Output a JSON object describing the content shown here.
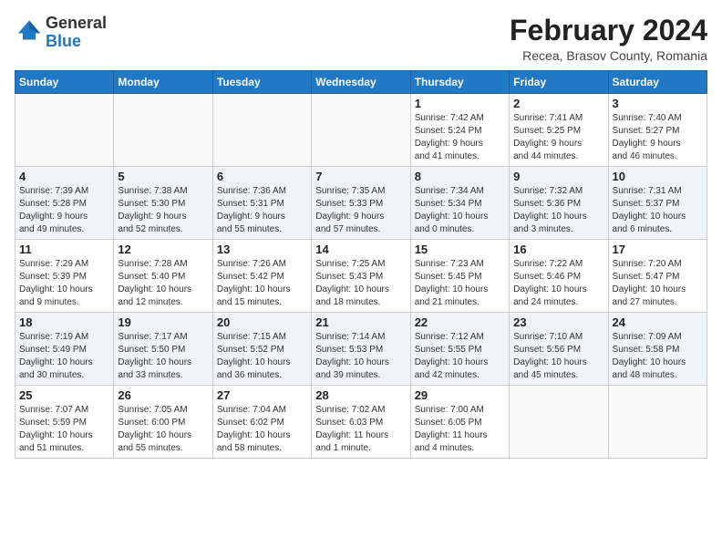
{
  "header": {
    "logo": {
      "line1": "General",
      "line2": "Blue"
    },
    "month": "February 2024",
    "location": "Recea, Brasov County, Romania"
  },
  "weekdays": [
    "Sunday",
    "Monday",
    "Tuesday",
    "Wednesday",
    "Thursday",
    "Friday",
    "Saturday"
  ],
  "weeks": [
    [
      {
        "day": "",
        "info": ""
      },
      {
        "day": "",
        "info": ""
      },
      {
        "day": "",
        "info": ""
      },
      {
        "day": "",
        "info": ""
      },
      {
        "day": "1",
        "info": "Sunrise: 7:42 AM\nSunset: 5:24 PM\nDaylight: 9 hours\nand 41 minutes."
      },
      {
        "day": "2",
        "info": "Sunrise: 7:41 AM\nSunset: 5:25 PM\nDaylight: 9 hours\nand 44 minutes."
      },
      {
        "day": "3",
        "info": "Sunrise: 7:40 AM\nSunset: 5:27 PM\nDaylight: 9 hours\nand 46 minutes."
      }
    ],
    [
      {
        "day": "4",
        "info": "Sunrise: 7:39 AM\nSunset: 5:28 PM\nDaylight: 9 hours\nand 49 minutes."
      },
      {
        "day": "5",
        "info": "Sunrise: 7:38 AM\nSunset: 5:30 PM\nDaylight: 9 hours\nand 52 minutes."
      },
      {
        "day": "6",
        "info": "Sunrise: 7:36 AM\nSunset: 5:31 PM\nDaylight: 9 hours\nand 55 minutes."
      },
      {
        "day": "7",
        "info": "Sunrise: 7:35 AM\nSunset: 5:33 PM\nDaylight: 9 hours\nand 57 minutes."
      },
      {
        "day": "8",
        "info": "Sunrise: 7:34 AM\nSunset: 5:34 PM\nDaylight: 10 hours\nand 0 minutes."
      },
      {
        "day": "9",
        "info": "Sunrise: 7:32 AM\nSunset: 5:36 PM\nDaylight: 10 hours\nand 3 minutes."
      },
      {
        "day": "10",
        "info": "Sunrise: 7:31 AM\nSunset: 5:37 PM\nDaylight: 10 hours\nand 6 minutes."
      }
    ],
    [
      {
        "day": "11",
        "info": "Sunrise: 7:29 AM\nSunset: 5:39 PM\nDaylight: 10 hours\nand 9 minutes."
      },
      {
        "day": "12",
        "info": "Sunrise: 7:28 AM\nSunset: 5:40 PM\nDaylight: 10 hours\nand 12 minutes."
      },
      {
        "day": "13",
        "info": "Sunrise: 7:26 AM\nSunset: 5:42 PM\nDaylight: 10 hours\nand 15 minutes."
      },
      {
        "day": "14",
        "info": "Sunrise: 7:25 AM\nSunset: 5:43 PM\nDaylight: 10 hours\nand 18 minutes."
      },
      {
        "day": "15",
        "info": "Sunrise: 7:23 AM\nSunset: 5:45 PM\nDaylight: 10 hours\nand 21 minutes."
      },
      {
        "day": "16",
        "info": "Sunrise: 7:22 AM\nSunset: 5:46 PM\nDaylight: 10 hours\nand 24 minutes."
      },
      {
        "day": "17",
        "info": "Sunrise: 7:20 AM\nSunset: 5:47 PM\nDaylight: 10 hours\nand 27 minutes."
      }
    ],
    [
      {
        "day": "18",
        "info": "Sunrise: 7:19 AM\nSunset: 5:49 PM\nDaylight: 10 hours\nand 30 minutes."
      },
      {
        "day": "19",
        "info": "Sunrise: 7:17 AM\nSunset: 5:50 PM\nDaylight: 10 hours\nand 33 minutes."
      },
      {
        "day": "20",
        "info": "Sunrise: 7:15 AM\nSunset: 5:52 PM\nDaylight: 10 hours\nand 36 minutes."
      },
      {
        "day": "21",
        "info": "Sunrise: 7:14 AM\nSunset: 5:53 PM\nDaylight: 10 hours\nand 39 minutes."
      },
      {
        "day": "22",
        "info": "Sunrise: 7:12 AM\nSunset: 5:55 PM\nDaylight: 10 hours\nand 42 minutes."
      },
      {
        "day": "23",
        "info": "Sunrise: 7:10 AM\nSunset: 5:56 PM\nDaylight: 10 hours\nand 45 minutes."
      },
      {
        "day": "24",
        "info": "Sunrise: 7:09 AM\nSunset: 5:58 PM\nDaylight: 10 hours\nand 48 minutes."
      }
    ],
    [
      {
        "day": "25",
        "info": "Sunrise: 7:07 AM\nSunset: 5:59 PM\nDaylight: 10 hours\nand 51 minutes."
      },
      {
        "day": "26",
        "info": "Sunrise: 7:05 AM\nSunset: 6:00 PM\nDaylight: 10 hours\nand 55 minutes."
      },
      {
        "day": "27",
        "info": "Sunrise: 7:04 AM\nSunset: 6:02 PM\nDaylight: 10 hours\nand 58 minutes."
      },
      {
        "day": "28",
        "info": "Sunrise: 7:02 AM\nSunset: 6:03 PM\nDaylight: 11 hours\nand 1 minute."
      },
      {
        "day": "29",
        "info": "Sunrise: 7:00 AM\nSunset: 6:05 PM\nDaylight: 11 hours\nand 4 minutes."
      },
      {
        "day": "",
        "info": ""
      },
      {
        "day": "",
        "info": ""
      }
    ]
  ]
}
